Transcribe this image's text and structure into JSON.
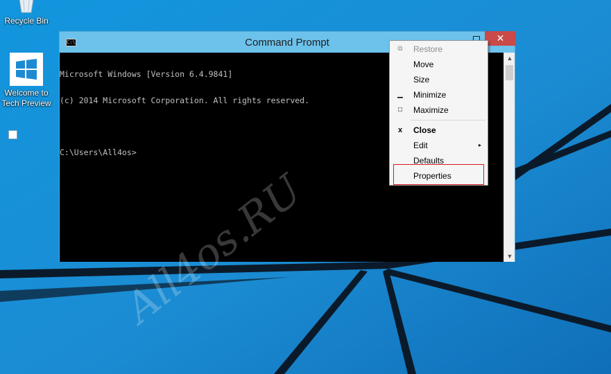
{
  "desktop": {
    "icons": [
      {
        "label": "Recycle Bin",
        "icon": "recycle-bin-icon"
      },
      {
        "label": "Welcome to Tech Preview",
        "icon": "windows-logo-icon"
      }
    ],
    "watermark": "All4os.RU"
  },
  "window": {
    "title": "Command Prompt",
    "close_glyph": "✕",
    "console_lines": [
      "Microsoft Windows [Version 6.4.9841]",
      "(c) 2014 Microsoft Corporation. All rights reserved.",
      "",
      "C:\\Users\\All4os>"
    ]
  },
  "system_menu": {
    "items": [
      {
        "label": "Restore",
        "icon": "restore-icon",
        "glyph": "⧉",
        "disabled": true
      },
      {
        "label": "Move",
        "icon": "",
        "glyph": ""
      },
      {
        "label": "Size",
        "icon": "",
        "glyph": ""
      },
      {
        "label": "Minimize",
        "icon": "minimize-icon",
        "glyph": "▁"
      },
      {
        "label": "Maximize",
        "icon": "maximize-icon",
        "glyph": "□"
      },
      {
        "label": "Close",
        "icon": "close-icon",
        "glyph": "x",
        "bold": true
      },
      {
        "label": "Edit",
        "icon": "",
        "glyph": "",
        "submenu": "▸"
      },
      {
        "label": "Defaults",
        "icon": "",
        "glyph": ""
      },
      {
        "label": "Properties",
        "icon": "",
        "glyph": "",
        "highlighted": true
      }
    ]
  },
  "colors": {
    "desktop_blue": "#1a8fd6",
    "titlebar_blue": "#6dc2ec",
    "close_red": "#c94a48",
    "highlight_red": "#d6191e"
  }
}
